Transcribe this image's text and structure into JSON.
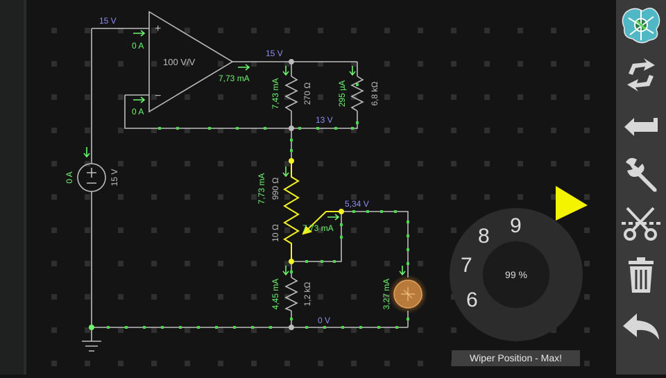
{
  "circuit": {
    "opamp_gain": "100 V/V",
    "opamp_plus": "+",
    "opamp_minus": "−",
    "source_voltage": "15 V",
    "source_current": "0 A",
    "in_plus_current": "0 A",
    "in_minus_current": "0 A",
    "opamp_out_current": "7,73 mA",
    "node_top_voltage": "15 V",
    "node_mid_voltage": "13 V",
    "node_wiper_voltage": "5,34 V",
    "node_ground_voltage": "0 V",
    "top_left_voltage": "15 V",
    "r270_value": "270 Ω",
    "r270_current": "7,43 mA",
    "r6k8_value": "6,8 kΩ",
    "r6k8_current": "295 µA",
    "pot_value_top": "990 Ω",
    "pot_value_bottom": "10 Ω",
    "pot_current": "7,73 mA",
    "wiper_current": "7,73 mA",
    "r1k2_value": "1,2 kΩ",
    "r1k2_current": "4,45 mA",
    "lamp_current": "3,27 mA"
  },
  "dial": {
    "percent": "99 %",
    "numbers": [
      "6",
      "7",
      "8",
      "9"
    ]
  },
  "status": {
    "wiper_label": "Wiper Position - Max!"
  },
  "toolbar": {
    "items": [
      "app-logo",
      "rotate",
      "wire",
      "tools",
      "cut",
      "delete",
      "undo"
    ]
  },
  "colors": {
    "wire": "#bdbdbd",
    "current_label": "#6cf66c",
    "voltage_label": "#8d8df5",
    "selected": "#f3f321",
    "grid_dot": "#343434",
    "dial_pointer": "#f4f400"
  }
}
